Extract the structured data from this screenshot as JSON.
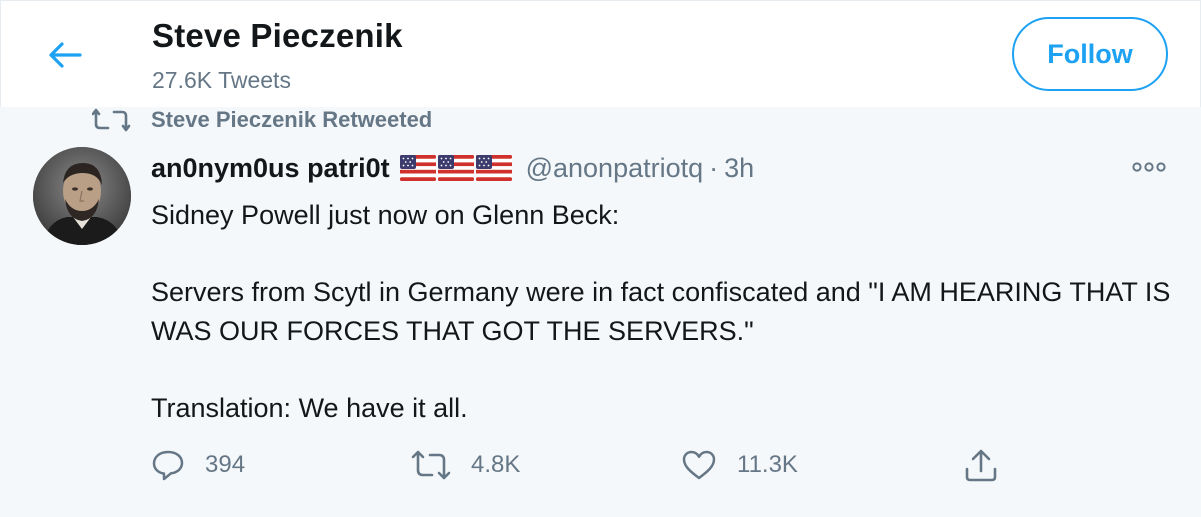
{
  "header": {
    "name": "Steve Pieczenik",
    "tweet_count": "27.6K Tweets",
    "follow_label": "Follow"
  },
  "tweet": {
    "retweet_label": "Steve Pieczenik Retweeted",
    "author": {
      "display_name": "an0nym0us patri0t",
      "flags": [
        "us-flag",
        "us-flag",
        "us-flag"
      ],
      "handle": "@anonpatriotq",
      "separator": "·",
      "time": "3h"
    },
    "text": "Sidney Powell just now on Glenn Beck:\n\nServers from Scytl in Germany were in fact confiscated and \"I AM HEARING THAT IS WAS OUR FORCES THAT GOT THE SERVERS.\"\n\nTranslation: We have it all.",
    "actions": {
      "replies": "394",
      "retweets": "4.8K",
      "likes": "11.3K"
    }
  },
  "colors": {
    "accent": "#1da1f2",
    "secondary_text": "#657786",
    "primary_text": "#14171a",
    "background": "#f5f8fa"
  }
}
